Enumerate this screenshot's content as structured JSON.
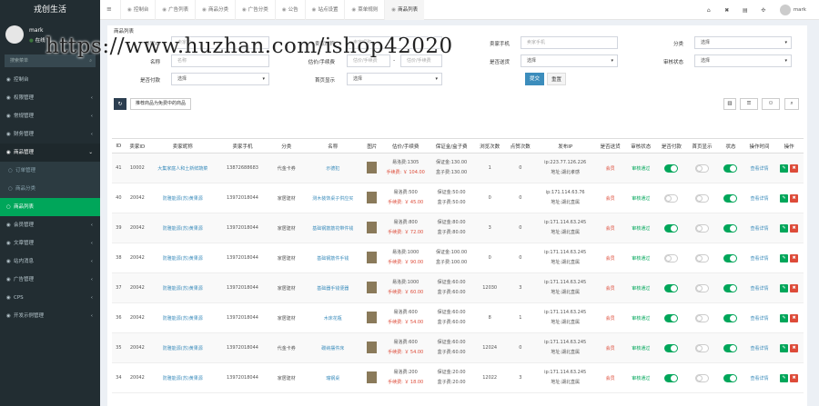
{
  "app": {
    "brand": "戎创生活"
  },
  "user": {
    "name": "mark",
    "status": "在线",
    "status_dot": "●"
  },
  "sidebar": {
    "search_placeholder": "搜索菜单",
    "items": [
      {
        "label": "控制台",
        "icon": "◉",
        "arrow": "",
        "cls": ""
      },
      {
        "label": "权限管理",
        "icon": "◉",
        "arrow": "‹",
        "cls": ""
      },
      {
        "label": "常规管理",
        "icon": "◉",
        "arrow": "‹",
        "cls": ""
      },
      {
        "label": "财务管理",
        "icon": "◉",
        "arrow": "‹",
        "cls": ""
      },
      {
        "label": "商品管理",
        "icon": "◉",
        "arrow": "⌄",
        "cls": "open"
      },
      {
        "label": "订单管理",
        "icon": "○",
        "arrow": "",
        "cls": "sub"
      },
      {
        "label": "商品分类",
        "icon": "○",
        "arrow": "",
        "cls": "sub"
      },
      {
        "label": "商品列表",
        "icon": "○",
        "arrow": "",
        "cls": "active"
      },
      {
        "label": "会员管理",
        "icon": "◉",
        "arrow": "‹",
        "cls": ""
      },
      {
        "label": "文章管理",
        "icon": "◉",
        "arrow": "‹",
        "cls": ""
      },
      {
        "label": "站内消息",
        "icon": "◉",
        "arrow": "‹",
        "cls": ""
      },
      {
        "label": "广告管理",
        "icon": "◉",
        "arrow": "‹",
        "cls": ""
      },
      {
        "label": "CPS",
        "icon": "◉",
        "arrow": "‹",
        "cls": ""
      },
      {
        "label": "开发示例管理",
        "icon": "◉",
        "arrow": "‹",
        "cls": ""
      }
    ]
  },
  "topbar": {
    "toggle": "≡",
    "tabs": [
      {
        "label": "控制台",
        "active": false
      },
      {
        "label": "广告列表",
        "active": false
      },
      {
        "label": "商品分类",
        "active": false
      },
      {
        "label": "广告分类",
        "active": false
      },
      {
        "label": "公告",
        "active": false
      },
      {
        "label": "站点设置",
        "active": false
      },
      {
        "label": "菜单规则",
        "active": false
      },
      {
        "label": "商品列表",
        "active": true
      }
    ],
    "right_icons": [
      "⌂",
      "✖",
      "▤",
      "✣"
    ],
    "user": "mark"
  },
  "panel": {
    "title": "商品列表"
  },
  "filters": {
    "row1": [
      {
        "label": "卖家ID",
        "placeholder": "卖家ID"
      },
      {
        "label": "卖家昵称",
        "placeholder": "卖家昵称"
      },
      {
        "label": "卖家手机",
        "placeholder": "卖家手机"
      },
      {
        "label": "分类",
        "value": "选择"
      }
    ],
    "row2": [
      {
        "label": "名称",
        "placeholder": "名称"
      },
      {
        "label": "估价/手续费",
        "placeholder_from": "估价/手续费",
        "placeholder_to": "估价/手续费",
        "sep": "-"
      },
      {
        "label": "是否送货",
        "value": "选择"
      },
      {
        "label": "审核状态",
        "value": "选择"
      }
    ],
    "row3": [
      {
        "label": "是否付款",
        "value": "选择"
      },
      {
        "label": "首页显示",
        "value": "选择"
      }
    ],
    "submit": "提交",
    "reset": "重置"
  },
  "toolbar": {
    "refresh": "↻",
    "send_label": "推荐商品为免费中的商品",
    "icons": [
      "▥",
      "☰",
      "⚇",
      "⌕"
    ]
  },
  "table": {
    "headers": [
      "ID",
      "卖家ID",
      "卖家昵称",
      "卖家手机",
      "分类",
      "名称",
      "图片",
      "估价/手续费",
      "保证金/盒子费",
      "浏览次数",
      "点赞次数",
      "发布IP",
      "是否送货",
      "审核状态",
      "是否付款",
      "首页显示",
      "状态",
      "操作时间",
      "操作"
    ],
    "rows": [
      {
        "id": "41",
        "seller_id": "10002",
        "nick": "大集家庭人和土新鲜蔬菜",
        "phone": "13872688683",
        "cat": "代金卡券",
        "name": "示德犯",
        "price": "易洛费:1305",
        "fee": "手续费: ￥ 104.00",
        "deposit": "保证金:130.00",
        "box": "盒子费:130.00",
        "views": "1",
        "likes": "0",
        "ip": "ip:223.77.126.226",
        "addr": "地址:湖北孝感",
        "ship": "会员",
        "audit": "审核通过",
        "paid": true,
        "home": false,
        "status": true,
        "detail": "查看详情",
        "edit": "✎",
        "del": "✖"
      },
      {
        "id": "40",
        "seller_id": "20042",
        "nick": "防雅能源(苏)黄果源",
        "phone": "13972018044",
        "cat": "家居建材",
        "name": "测木装饰桌子供应买",
        "price": "易洛费:500",
        "fee": "手续费: ￥ 45.00",
        "deposit": "保证金:50.00",
        "box": "盒子费:50.00",
        "views": "0",
        "likes": "0",
        "ip": "ip:171.114.63.76",
        "addr": "地址:湖北直属",
        "ship": "会员",
        "audit": "审核通过",
        "paid": false,
        "home": false,
        "status": true,
        "detail": "查看详情",
        "edit": "✎",
        "del": "✖"
      },
      {
        "id": "39",
        "seller_id": "20042",
        "nick": "防雅能源(苏)黄果源",
        "phone": "13972018044",
        "cat": "家居建材",
        "name": "基础钢筋筋花带件钱",
        "price": "易洛费:800",
        "fee": "手续费: ￥ 72.00",
        "deposit": "保证金:80.00",
        "box": "盒子费:80.00",
        "views": "3",
        "likes": "0",
        "ip": "ip:171.114.63.245",
        "addr": "地址:湖北直属",
        "ship": "会员",
        "audit": "审核通过",
        "paid": true,
        "home": false,
        "status": true,
        "detail": "查看详情",
        "edit": "✎",
        "del": "✖"
      },
      {
        "id": "38",
        "seller_id": "20042",
        "nick": "防雅能源(苏)黄果源",
        "phone": "13972018044",
        "cat": "家居建材",
        "name": "基础钢筋件手钱",
        "price": "易洛费:1000",
        "fee": "手续费: ￥ 90.00",
        "deposit": "保证金:100.00",
        "box": "盒子费:100.00",
        "views": "0",
        "likes": "0",
        "ip": "ip:171.114.63.245",
        "addr": "地址:湖北直属",
        "ship": "会员",
        "audit": "审核通过",
        "paid": false,
        "home": false,
        "status": true,
        "detail": "查看详情",
        "edit": "✎",
        "del": "✖"
      },
      {
        "id": "37",
        "seller_id": "20042",
        "nick": "防雅能源(苏)黄果源",
        "phone": "13972018044",
        "cat": "家居建材",
        "name": "基础器手钱便器",
        "price": "易洛费:1000",
        "fee": "手续费: ￥ 60.00",
        "deposit": "保证金:60.00",
        "box": "盒子费:60.00",
        "views": "12030",
        "likes": "3",
        "ip": "ip:171.114.63.245",
        "addr": "地址:湖北直属",
        "ship": "会员",
        "audit": "审核通过",
        "paid": true,
        "home": false,
        "status": true,
        "detail": "查看详情",
        "edit": "✎",
        "del": "✖"
      },
      {
        "id": "36",
        "seller_id": "20042",
        "nick": "防雅能源(苏)黄果源",
        "phone": "13972018044",
        "cat": "家居建材",
        "name": "木床花瓶",
        "price": "易洛费:600",
        "fee": "手续费: ￥ 54.00",
        "deposit": "保证金:60.00",
        "box": "盒子费:60.00",
        "views": "8",
        "likes": "1",
        "ip": "ip:171.114.63.245",
        "addr": "地址:湖北直属",
        "ship": "会员",
        "audit": "审核通过",
        "paid": true,
        "home": false,
        "status": true,
        "detail": "查看详情",
        "edit": "✎",
        "del": "✖"
      },
      {
        "id": "35",
        "seller_id": "20042",
        "nick": "防雅能源(苏)黄果源",
        "phone": "13972018044",
        "cat": "代金卡券",
        "name": "碳纳摆件床",
        "price": "易洛费:600",
        "fee": "手续费: ￥ 54.00",
        "deposit": "保证金:60.00",
        "box": "盒子费:60.00",
        "views": "12024",
        "likes": "0",
        "ip": "ip:171.114.63.245",
        "addr": "地址:湖北直属",
        "ship": "会员",
        "audit": "审核通过",
        "paid": true,
        "home": false,
        "status": true,
        "detail": "查看详情",
        "edit": "✎",
        "del": "✖"
      },
      {
        "id": "34",
        "seller_id": "20042",
        "nick": "防雅能源(苏)黄果源",
        "phone": "13972018044",
        "cat": "家居建材",
        "name": "瑞钢桌",
        "price": "易洛费:200",
        "fee": "手续费: ￥ 18.00",
        "deposit": "保证金:20.00",
        "box": "盒子费:20.00",
        "views": "12022",
        "likes": "3",
        "ip": "ip:171.114.63.245",
        "addr": "地址:湖北直属",
        "ship": "会员",
        "audit": "审核通过",
        "paid": true,
        "home": false,
        "status": true,
        "detail": "查看详情",
        "edit": "✎",
        "del": "✖"
      }
    ]
  },
  "watermark": "https://www.huzhan.com/ishop42020"
}
